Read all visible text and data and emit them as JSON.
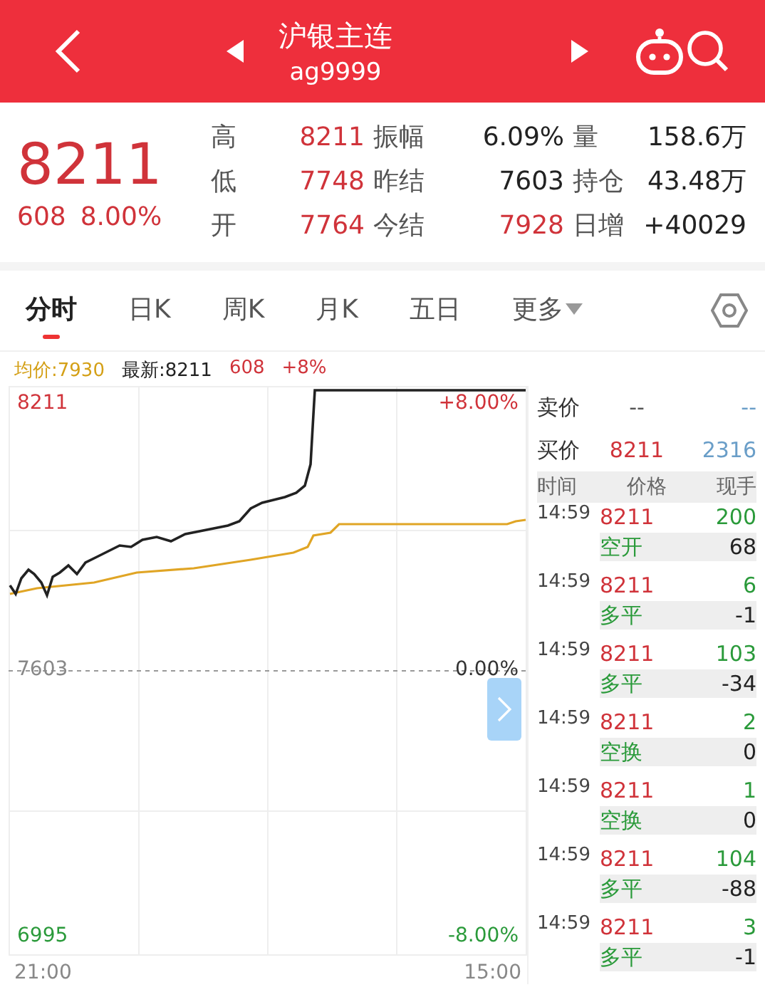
{
  "header": {
    "title": "沪银主连",
    "code": "ag9999"
  },
  "quote": {
    "price": "8211",
    "change": "608",
    "change_pct": "8.00%",
    "stats": [
      [
        {
          "label": "高",
          "value": "8211",
          "kind": "up"
        },
        {
          "label": "振幅",
          "value": "6.09%",
          "kind": "flat"
        },
        {
          "label": "量",
          "value": "158.6万",
          "kind": "flat"
        }
      ],
      [
        {
          "label": "低",
          "value": "7748",
          "kind": "up"
        },
        {
          "label": "昨结",
          "value": "7603",
          "kind": "flat"
        },
        {
          "label": "持仓",
          "value": "43.48万",
          "kind": "flat"
        }
      ],
      [
        {
          "label": "开",
          "value": "7764",
          "kind": "up"
        },
        {
          "label": "今结",
          "value": "7928",
          "kind": "up"
        },
        {
          "label": "日增",
          "value": "+40029",
          "kind": "flat"
        }
      ]
    ]
  },
  "tabs": [
    {
      "label": "分时",
      "selected": true
    },
    {
      "label": "日K",
      "selected": false
    },
    {
      "label": "周K",
      "selected": false
    },
    {
      "label": "月K",
      "selected": false
    },
    {
      "label": "五日",
      "selected": false
    }
  ],
  "more_tab": {
    "label": "更多",
    "selected": false
  },
  "info": {
    "avg": "均价:7930",
    "latest": "最新:8211",
    "change": "608",
    "pct": "+8%"
  },
  "chart": {
    "price_labels": [
      "8211",
      "7603",
      "6995"
    ],
    "pct_labels": [
      "+8.00%",
      "0.00%",
      "-8.00%"
    ],
    "start_time": "21:00",
    "end_time": "15:00"
  },
  "book": [
    {
      "label": "卖价",
      "price": "--",
      "volume": "--",
      "quoted": false
    },
    {
      "label": "买价",
      "price": "8211",
      "volume": "2316",
      "quoted": true
    }
  ],
  "ticks_header": [
    "时间",
    "价格",
    "现手"
  ],
  "ticks": [
    {
      "time": "14:59",
      "price": "8211",
      "volume": "200",
      "type": "空开",
      "delta": "68"
    },
    {
      "time": "14:59",
      "price": "8211",
      "volume": "6",
      "type": "多平",
      "delta": "-1"
    },
    {
      "time": "14:59",
      "price": "8211",
      "volume": "103",
      "type": "多平",
      "delta": "-34"
    },
    {
      "time": "14:59",
      "price": "8211",
      "volume": "2",
      "type": "空换",
      "delta": "0"
    },
    {
      "time": "14:59",
      "price": "8211",
      "volume": "1",
      "type": "空换",
      "delta": "0"
    },
    {
      "time": "14:59",
      "price": "8211",
      "volume": "104",
      "type": "多平",
      "delta": "-88"
    },
    {
      "time": "14:59",
      "price": "8211",
      "volume": "3",
      "type": "多平",
      "delta": "-1"
    }
  ]
}
